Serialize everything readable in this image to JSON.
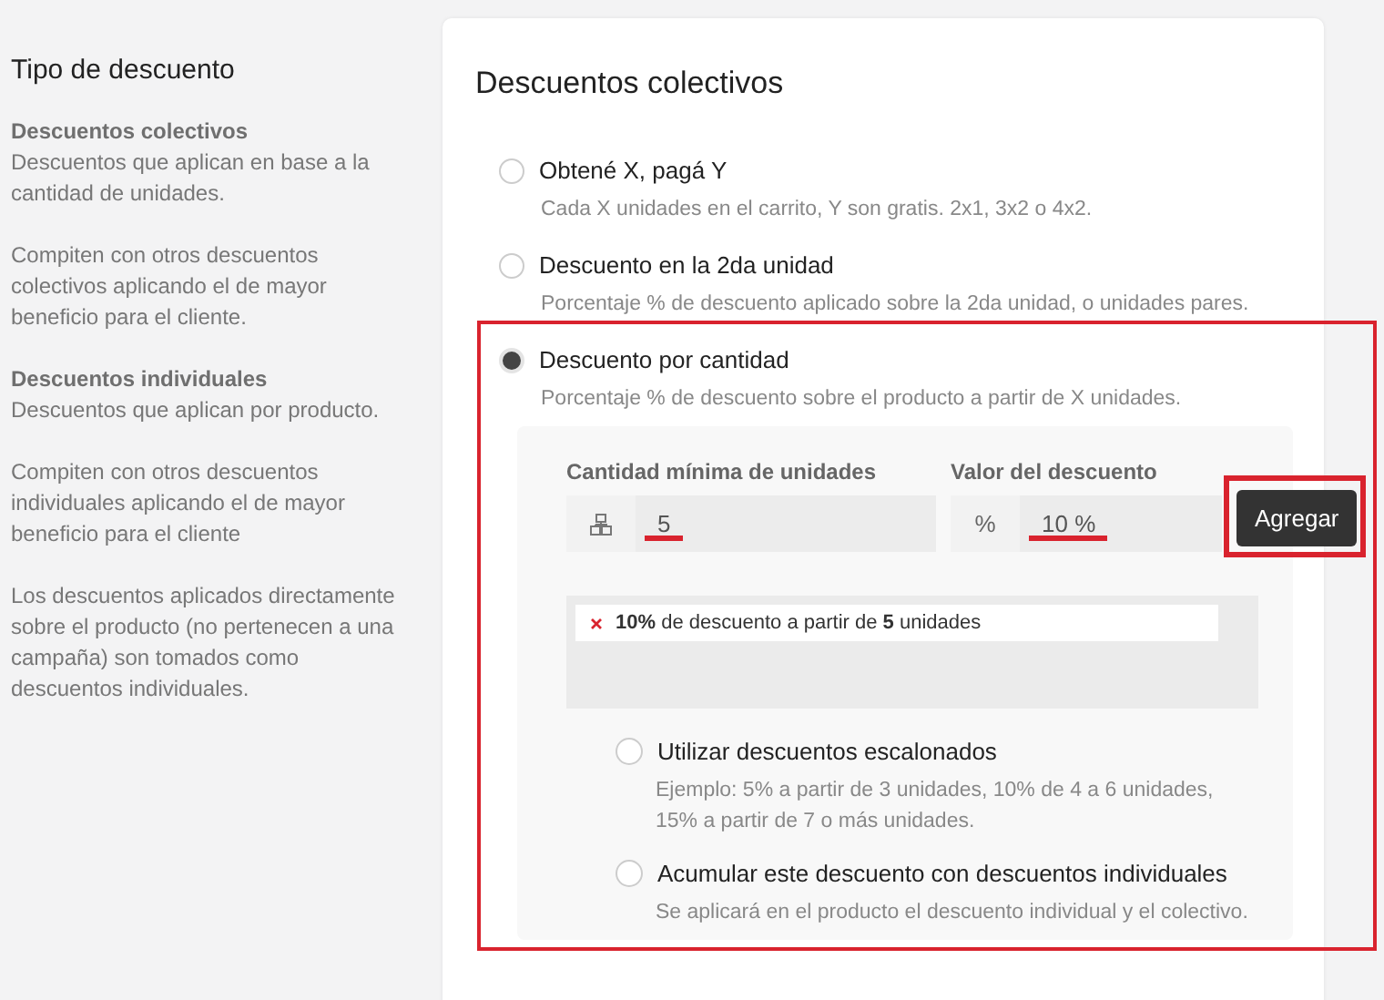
{
  "sidebar": {
    "title": "Tipo de descuento",
    "blocks": [
      {
        "heading": "Descuentos colectivos",
        "text": "Descuentos que aplican en base a la cantidad de unidades."
      },
      {
        "text": "Compiten con otros descuentos colectivos aplicando el de mayor beneficio para el cliente."
      },
      {
        "heading": "Descuentos individuales",
        "text": "Descuentos que aplican por producto."
      },
      {
        "text": "Compiten con otros descuentos individuales aplicando el de mayor beneficio para el cliente"
      },
      {
        "text": "Los descuentos aplicados directamente sobre el producto (no pertenecen a una campaña) son tomados como descuentos individuales."
      }
    ]
  },
  "card": {
    "title": "Descuentos colectivos",
    "options": [
      {
        "label": "Obtené X, pagá Y",
        "description": "Cada X unidades en el carrito, Y son gratis. 2x1, 3x2 o 4x2.",
        "selected": false
      },
      {
        "label": "Descuento en la 2da unidad",
        "description": "Porcentaje % de descuento aplicado sobre la 2da unidad, o unidades pares.",
        "selected": false
      },
      {
        "label": "Descuento por cantidad",
        "description": "Porcentaje % de descuento sobre el producto a partir de X unidades.",
        "selected": true
      }
    ],
    "quantity_panel": {
      "fields": [
        {
          "label": "Cantidad mínima de unidades",
          "kind": "icon",
          "value": "5"
        },
        {
          "label": "Valor del descuento",
          "kind": "text",
          "prefix": "%",
          "value": "10 %"
        }
      ],
      "button": "Agregar",
      "rules": [
        {
          "text": "**10%** de descuento a partir de **5** unidades"
        }
      ],
      "extras": [
        {
          "label": "Utilizar descuentos escalonados",
          "description": "Ejemplo: 5% a partir de 3 unidades, 10% de 4 a 6 unidades, 15% a partir de 7 o más unidades.",
          "selected": false
        },
        {
          "label": "Acumular este descuento con descuentos individuales",
          "description": "Se aplicará en el producto el descuento individual y el colectivo.",
          "selected": false
        }
      ]
    }
  }
}
